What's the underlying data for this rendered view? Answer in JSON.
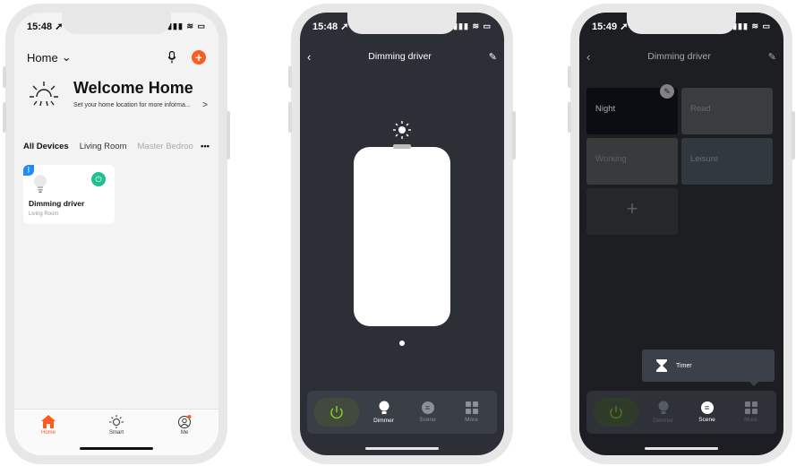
{
  "phone1": {
    "status_time": "15:48",
    "home_select": "Home",
    "welcome_title": "Welcome Home",
    "welcome_sub": "Set your home location for more informa...",
    "rooms": [
      "All Devices",
      "Living Room",
      "Master Bedroo"
    ],
    "more": "•••",
    "device": {
      "name": "Dimming driver",
      "room": "Living Room"
    },
    "tabs": [
      "Home",
      "Smart",
      "Me"
    ]
  },
  "phone2": {
    "status_time": "15:48",
    "title": "Dimming driver",
    "controls": [
      "Dimmer",
      "Scene",
      "More"
    ]
  },
  "phone3": {
    "status_time": "15:49",
    "title": "Dimming driver",
    "scenes": [
      "Night",
      "Read",
      "Working",
      "Leisure"
    ],
    "add": "+",
    "popup_label": "Timer",
    "controls": [
      "Dimmer",
      "Scene",
      "More"
    ]
  },
  "colors": {
    "accent": "#ff5a1f",
    "power_green": "#1fbf8f",
    "bluetooth": "#1e8cf0",
    "dark_bg": "#2c2f35"
  }
}
